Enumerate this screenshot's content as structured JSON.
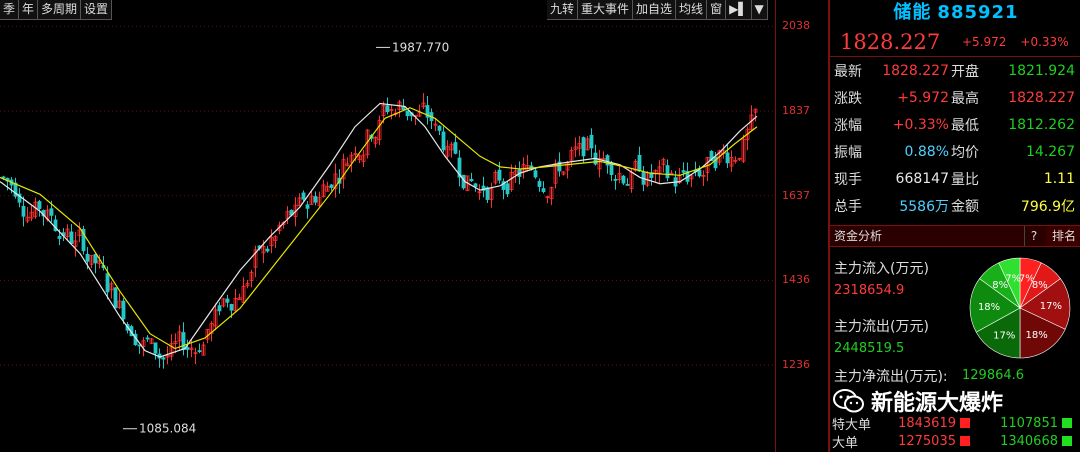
{
  "toolbar": {
    "left": [
      "季",
      "年",
      "多周期",
      "设置"
    ],
    "right": [
      "九转",
      "重大事件",
      "加自选",
      "均线",
      "窗",
      "▶▌",
      "▼"
    ]
  },
  "y_axis": {
    "ticks": [
      "2038",
      "1837",
      "1637",
      "1436",
      "1236"
    ]
  },
  "chart_data": {
    "type": "candlestick",
    "annotations": [
      {
        "label": "1987.770",
        "x": 376,
        "y": 1987.77
      },
      {
        "label": "1085.084",
        "x": 123,
        "y": 1085.084
      }
    ],
    "ylim": [
      1030,
      2100
    ],
    "y_ticks": [
      2038,
      1837,
      1637,
      1436,
      1236
    ],
    "ma_lines": [
      {
        "color": "#e8e8e8",
        "points": [
          [
            0,
            1670
          ],
          [
            40,
            1600
          ],
          [
            80,
            1500
          ],
          [
            120,
            1350
          ],
          [
            145,
            1270
          ],
          [
            160,
            1255
          ],
          [
            185,
            1275
          ],
          [
            210,
            1360
          ],
          [
            240,
            1460
          ],
          [
            270,
            1540
          ],
          [
            300,
            1610
          ],
          [
            330,
            1710
          ],
          [
            355,
            1800
          ],
          [
            380,
            1855
          ],
          [
            405,
            1848
          ],
          [
            425,
            1800
          ],
          [
            445,
            1730
          ],
          [
            465,
            1670
          ],
          [
            480,
            1650
          ],
          [
            500,
            1660
          ],
          [
            520,
            1690
          ],
          [
            540,
            1705
          ],
          [
            565,
            1715
          ],
          [
            595,
            1725
          ],
          [
            620,
            1710
          ],
          [
            640,
            1680
          ],
          [
            660,
            1665
          ],
          [
            680,
            1670
          ],
          [
            700,
            1700
          ],
          [
            720,
            1740
          ],
          [
            740,
            1790
          ],
          [
            757,
            1825
          ]
        ]
      },
      {
        "color": "#e6e600",
        "points": [
          [
            0,
            1680
          ],
          [
            40,
            1640
          ],
          [
            80,
            1560
          ],
          [
            120,
            1410
          ],
          [
            150,
            1310
          ],
          [
            175,
            1275
          ],
          [
            205,
            1300
          ],
          [
            240,
            1370
          ],
          [
            270,
            1460
          ],
          [
            300,
            1550
          ],
          [
            330,
            1640
          ],
          [
            360,
            1740
          ],
          [
            385,
            1820
          ],
          [
            410,
            1845
          ],
          [
            435,
            1820
          ],
          [
            460,
            1770
          ],
          [
            480,
            1730
          ],
          [
            500,
            1705
          ],
          [
            520,
            1700
          ],
          [
            545,
            1705
          ],
          [
            575,
            1712
          ],
          [
            600,
            1718
          ],
          [
            625,
            1705
          ],
          [
            650,
            1690
          ],
          [
            680,
            1685
          ],
          [
            710,
            1710
          ],
          [
            735,
            1760
          ],
          [
            757,
            1800
          ]
        ]
      }
    ]
  },
  "stock": {
    "name": "储能",
    "code": "885921",
    "price": "1828.227",
    "change": "+5.972",
    "change_pct": "+0.33%"
  },
  "quote_rows": [
    {
      "l1": "最新",
      "v1": "1828.227",
      "c1": "red",
      "l2": "开盘",
      "v2": "1821.924",
      "c2": "grn"
    },
    {
      "l1": "涨跌",
      "v1": "+5.972",
      "c1": "red",
      "l2": "最高",
      "v2": "1828.227",
      "c2": "red"
    },
    {
      "l1": "涨幅",
      "v1": "+0.33%",
      "c1": "red",
      "l2": "最低",
      "v2": "1812.262",
      "c2": "grn"
    },
    {
      "l1": "振幅",
      "v1": "0.88%",
      "c1": "cyan",
      "l2": "均价",
      "v2": "14.267",
      "c2": "grn"
    },
    {
      "l1": "现手",
      "v1": "668147",
      "c1": "wht",
      "l2": "量比",
      "v2": "1.11",
      "c2": "yel"
    },
    {
      "l1": "总手",
      "v1": "5586万",
      "c1": "cyan",
      "l2": "金额",
      "v2": "796.9亿",
      "c2": "yel"
    }
  ],
  "fund": {
    "title": "资金分析",
    "help": "?",
    "rank": "排名",
    "inflow_label": "主力流入(万元)",
    "inflow": "2318654.9",
    "outflow_label": "主力流出(万元)",
    "outflow": "2448519.5",
    "net_label": "主力净流出(万元):",
    "net": "129864.6",
    "pie": [
      {
        "label": "7%",
        "value": 7,
        "color": "#ff2020"
      },
      {
        "label": "8%",
        "value": 8,
        "color": "#e01818"
      },
      {
        "label": "17%",
        "value": 17,
        "color": "#a01010"
      },
      {
        "label": "18%",
        "value": 18,
        "color": "#700808"
      },
      {
        "label": "17%",
        "value": 17,
        "color": "#0a6a0a"
      },
      {
        "label": "18%",
        "value": 18,
        "color": "#0e8a0e"
      },
      {
        "label": "8%",
        "value": 8,
        "color": "#18b018"
      },
      {
        "label": "7%",
        "value": 7,
        "color": "#30e030"
      }
    ],
    "bottom": [
      {
        "label": "特大单",
        "buy": "1843619",
        "sell": "1107851"
      },
      {
        "label": "大单",
        "buy": "1275035",
        "sell": "1340668"
      }
    ]
  },
  "watermark": {
    "text": "新能源大爆炸"
  }
}
